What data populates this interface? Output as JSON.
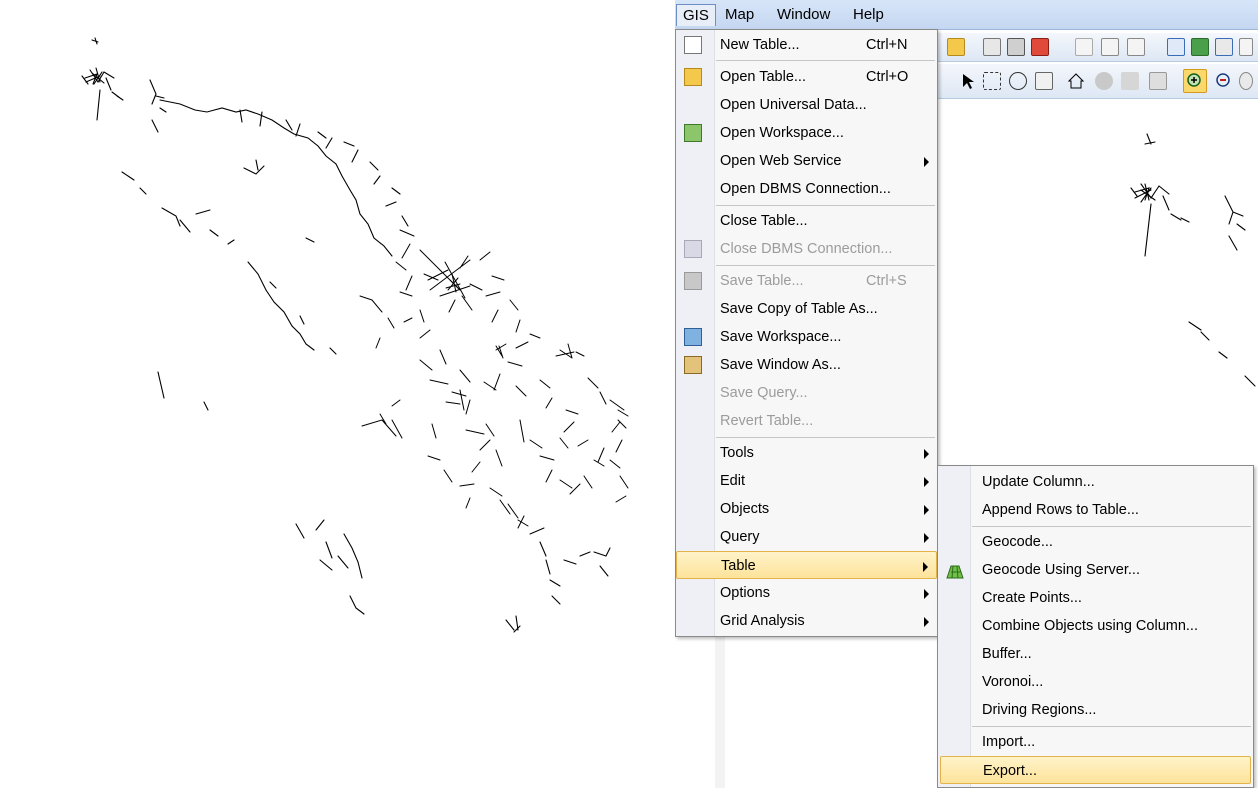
{
  "menubar": {
    "items": [
      "GIS",
      "Map",
      "Window",
      "Help"
    ]
  },
  "gis_menu": {
    "items": [
      {
        "label": "New Table...",
        "shortcut": "Ctrl+N",
        "icon": "new-table-icon"
      },
      {
        "label": "Open Table...",
        "shortcut": "Ctrl+O",
        "icon": "open-table-icon"
      },
      {
        "label": "Open Universal Data..."
      },
      {
        "label": "Open Workspace...",
        "icon": "open-workspace-icon"
      },
      {
        "label": "Open Web Service",
        "submenu": true
      },
      {
        "label": "Open DBMS Connection..."
      },
      {
        "label": "Close Table..."
      },
      {
        "label": "Close DBMS Connection...",
        "disabled": true,
        "icon": "close-dbms-icon"
      },
      {
        "label": "Save Table...",
        "shortcut": "Ctrl+S",
        "disabled": true,
        "icon": "save-icon"
      },
      {
        "label": "Save Copy of Table As..."
      },
      {
        "label": "Save Workspace...",
        "icon": "save-workspace-icon"
      },
      {
        "label": "Save Window As...",
        "icon": "save-window-icon"
      },
      {
        "label": "Save Query...",
        "disabled": true
      },
      {
        "label": "Revert Table...",
        "disabled": true
      },
      {
        "label": "Tools",
        "submenu": true
      },
      {
        "label": "Edit",
        "submenu": true
      },
      {
        "label": "Objects",
        "submenu": true
      },
      {
        "label": "Query",
        "submenu": true
      },
      {
        "label": "Table",
        "submenu": true,
        "highlighted": true
      },
      {
        "label": "Options",
        "submenu": true
      },
      {
        "label": "Grid Analysis",
        "submenu": true
      }
    ]
  },
  "table_submenu": {
    "items": [
      {
        "label": "Update Column..."
      },
      {
        "label": "Append Rows to Table..."
      },
      {
        "label": "Geocode..."
      },
      {
        "label": "Geocode Using Server...",
        "icon": "geocode-server-icon"
      },
      {
        "label": "Create Points..."
      },
      {
        "label": "Combine Objects using Column..."
      },
      {
        "label": "Buffer..."
      },
      {
        "label": "Voronoi..."
      },
      {
        "label": "Driving Regions..."
      },
      {
        "label": "Import..."
      },
      {
        "label": "Export...",
        "highlighted": true
      }
    ]
  },
  "colors": {
    "highlight": "#fde39b",
    "highlight_border": "#e3b24a",
    "menubar": "#c4d7f1",
    "disabled_text": "#9c9c9c"
  }
}
